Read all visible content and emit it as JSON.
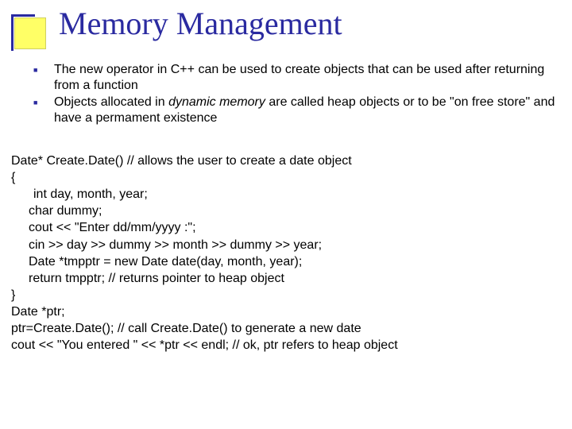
{
  "title": "Memory Management",
  "bullets": [
    {
      "pre": "The new operator in C++ can be used to create objects that can be used after returning from a function"
    },
    {
      "pre": "Objects allocated in ",
      "em": "dynamic memory",
      "post": " are called  heap objects or to be \"on free store\" and have a permament existence"
    }
  ],
  "code": {
    "l0": "Date*  Create.Date()  // allows the user to create a date object",
    "l1": "{",
    "l2": " int day, month, year;",
    "l3": "char dummy;",
    "l4": "cout << \"Enter dd/mm/yyyy :\";",
    "l5": "cin >> day >> dummy >> month >> dummy >> year;",
    "l6": "Date *tmpptr = new Date date(day, month, year);",
    "l7": "return tmpptr;    // returns pointer to heap object",
    "l8": "}",
    "l9": "Date *ptr;",
    "l10": "ptr=Create.Date(); // call Create.Date() to generate a new date",
    "l11": "cout << \"You entered \" << *ptr << endl;   // ok, ptr refers to heap object"
  }
}
